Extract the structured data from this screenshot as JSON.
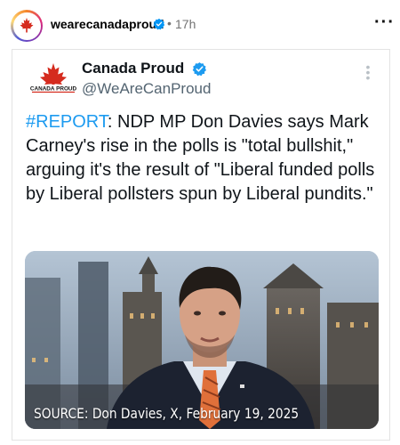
{
  "post": {
    "username": "wearecanadaproud",
    "dot": "•",
    "time": "17h",
    "more_icon": "more-horizontal-icon"
  },
  "tweet": {
    "display_name": "Canada Proud",
    "handle": "@WeAreCanProud",
    "avatar_logo_text": "CANADA PROUD",
    "hashtag": "#REPORT",
    "body": ": NDP MP Don Davies says Mark Carney's rise in the polls is \"total bullshit,\" arguing it's the result of \"Liberal funded polls by Liberal pollsters spun by Liberal pundits.\"",
    "media_caption": "SOURCE: Don Davies, X, February 19, 2025"
  },
  "colors": {
    "accent_blue": "#1d9bf0",
    "maple_red": "#d52b1e",
    "tie_orange": "#e0703a"
  }
}
